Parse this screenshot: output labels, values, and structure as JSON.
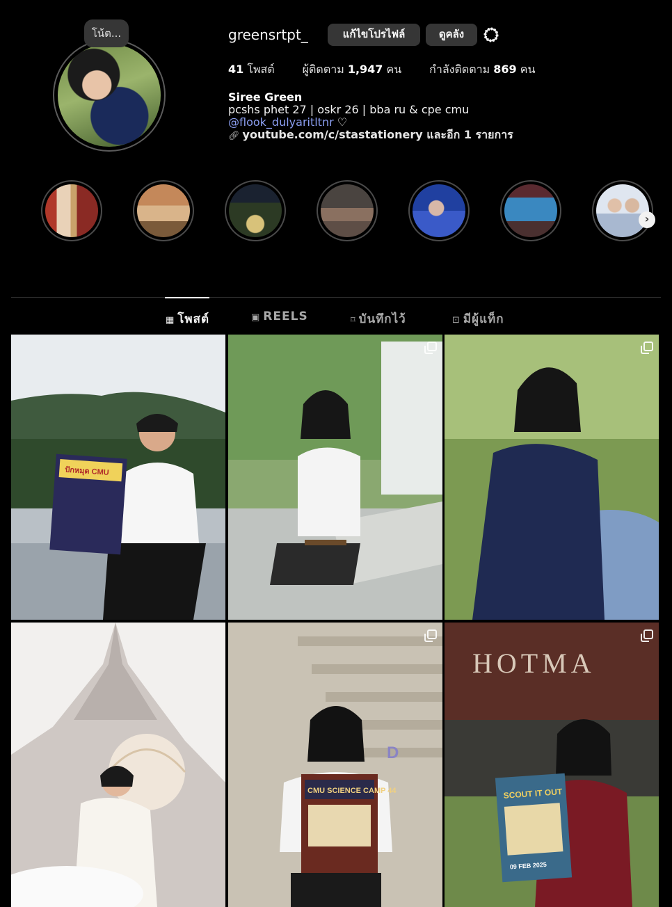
{
  "profile": {
    "note": "โน้ต...",
    "username": "greensrtpt_",
    "edit_button": "แก้ไขโปรไฟล์",
    "archive_button": "ดูคลัง",
    "stats": {
      "posts_count": "41",
      "posts_label": "โพสต์",
      "followers_label": "ผู้ติดตาม",
      "followers_count": "1,947",
      "followers_unit": "คน",
      "following_label": "กำลังติดตาม",
      "following_count": "869",
      "following_unit": "คน"
    },
    "bio": {
      "name": "Siree Green",
      "line1": "pcshs phet 27 | oskr 26 | bba ru & cpe cmu",
      "mention": "@flook_dulyaritltnr",
      "mention_suffix": "♡",
      "link": "youtube.com/c/stastationery และอีก 1 รายการ"
    }
  },
  "highlights_next": "›",
  "tabs": [
    {
      "label": "โพสต์",
      "icon": "grid-icon",
      "glyph": "▦"
    },
    {
      "label": "REELS",
      "icon": "reels-icon",
      "glyph": "▣"
    },
    {
      "label": "บันทึกไว้",
      "icon": "bookmark-icon",
      "glyph": "⌑"
    },
    {
      "label": "มีผู้แท็ก",
      "icon": "tagged-icon",
      "glyph": "⊡"
    }
  ],
  "posters": {
    "post1": "ปักหมุด CMU",
    "post5": "CMU SCIENCE CAMP 44",
    "post6_title": "SCOUT IT OUT",
    "post6_date": "09 FEB 2025",
    "post6_building": "HOTMA"
  },
  "colors": {
    "background": "#000000",
    "button": "#363636",
    "mention": "#8c9ff2"
  }
}
